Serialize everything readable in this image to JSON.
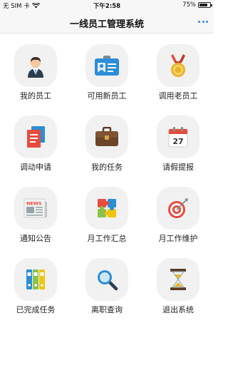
{
  "status_bar": {
    "carrier": "无 SIM 卡",
    "time": "下午2:58",
    "battery": "75%",
    "battery_level": 0.75
  },
  "header": {
    "title": "一线员工管理系统"
  },
  "tiles": [
    {
      "label": "我的员工",
      "icon": "employee-icon"
    },
    {
      "label": "可用新员工",
      "icon": "id-card-icon"
    },
    {
      "label": "调用老员工",
      "icon": "medal-icon"
    },
    {
      "label": "调动申请",
      "icon": "documents-icon"
    },
    {
      "label": "我的任务",
      "icon": "briefcase-icon"
    },
    {
      "label": "请假提报",
      "icon": "calendar-icon",
      "calendar_day": "27"
    },
    {
      "label": "通知公告",
      "icon": "newspaper-icon",
      "news_text": "NEWS"
    },
    {
      "label": "月工作汇总",
      "icon": "puzzle-icon"
    },
    {
      "label": "月工作维护",
      "icon": "target-icon"
    },
    {
      "label": "已完成任务",
      "icon": "binders-icon"
    },
    {
      "label": "离职查询",
      "icon": "magnifier-icon"
    },
    {
      "label": "退出系统",
      "icon": "hourglass-icon"
    }
  ]
}
